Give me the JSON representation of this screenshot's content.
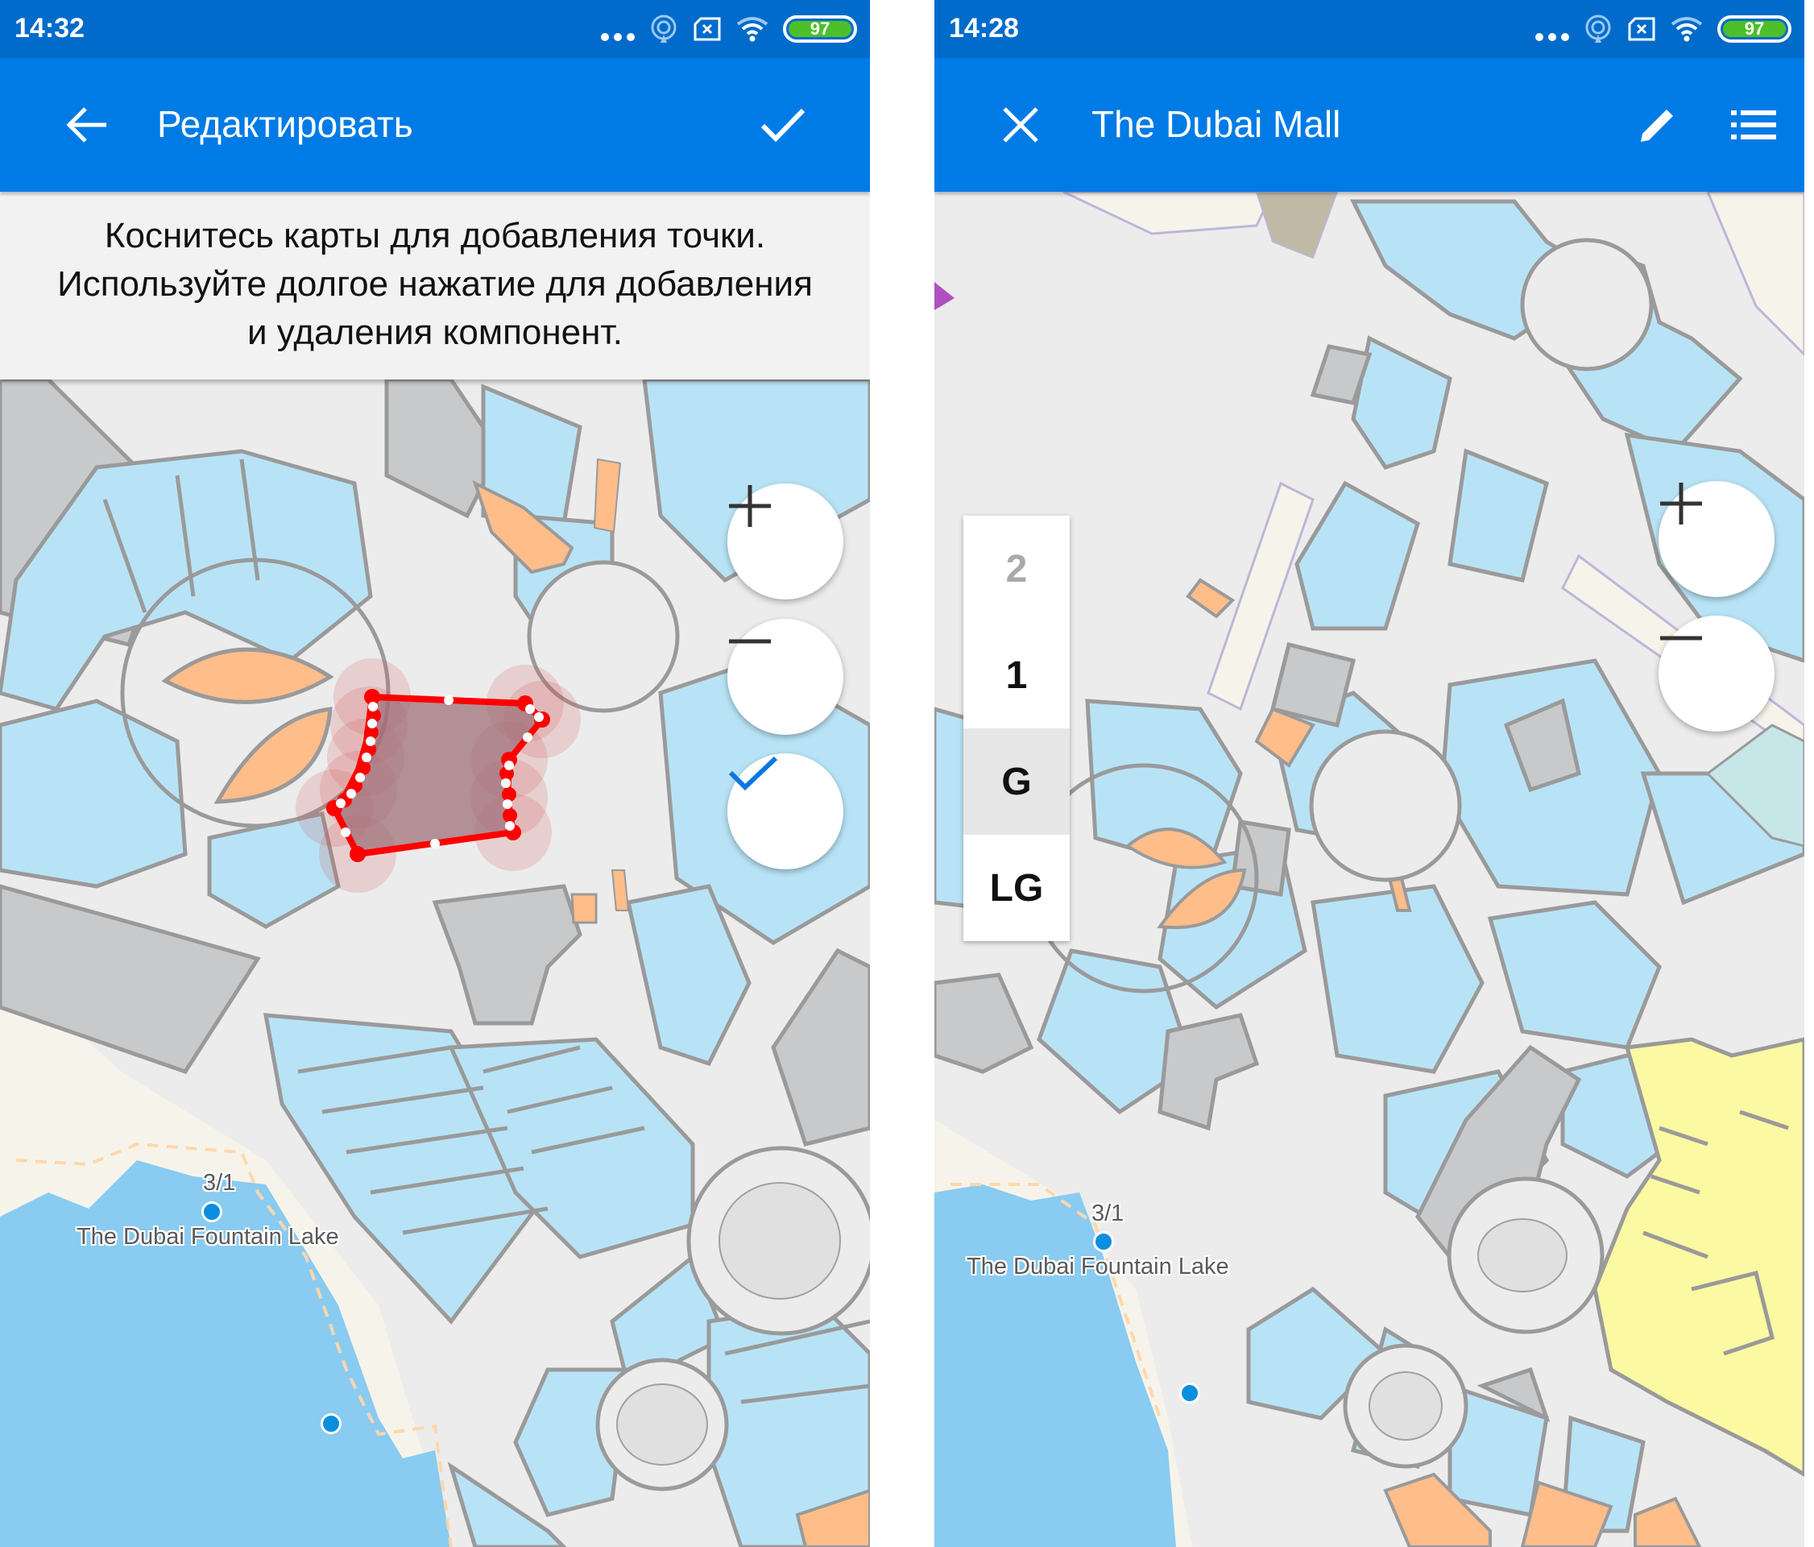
{
  "left_screen": {
    "status_bar": {
      "time": "14:32",
      "battery": "97",
      "icons": [
        "more-dots-icon",
        "hotspot-icon",
        "sim-off-icon",
        "wifi-icon",
        "battery-icon"
      ]
    },
    "app_bar": {
      "nav_icon": "back-arrow-icon",
      "title": "Редактировать",
      "action_icon": "check-icon"
    },
    "instruction": {
      "lines": [
        "Коснитесь карты для добавления точки.",
        "Используйте долгое нажатие для добавления",
        "и удаления компонент."
      ]
    },
    "map": {
      "labels": {
        "lake": "The Dubai Fountain Lake",
        "marker": "3/1"
      },
      "controls": {
        "zoom_in": "zoom-in-icon",
        "zoom_out": "zoom-out-icon",
        "confirm": "check-icon"
      },
      "edit_polygon": {
        "stroke_color": "#ff0000",
        "fill_color": "#a0707a"
      }
    }
  },
  "right_screen": {
    "status_bar": {
      "time": "14:28",
      "battery": "97",
      "icons": [
        "more-dots-icon",
        "hotspot-icon",
        "sim-off-icon",
        "wifi-icon",
        "battery-icon"
      ]
    },
    "app_bar": {
      "nav_icon": "close-icon",
      "title": "The Dubai Mall",
      "actions": [
        "edit-pencil-icon",
        "list-icon"
      ]
    },
    "floor_selector": {
      "floors": [
        {
          "label": "2",
          "state": "disabled"
        },
        {
          "label": "1",
          "state": "normal"
        },
        {
          "label": "G",
          "state": "selected"
        },
        {
          "label": "LG",
          "state": "normal"
        }
      ],
      "selected": "G"
    },
    "map": {
      "labels": {
        "lake": "The Dubai Fountain Lake",
        "marker": "3/1"
      },
      "controls": {
        "zoom_in": "zoom-in-icon",
        "zoom_out": "zoom-out-icon"
      }
    }
  },
  "colors": {
    "status_bar": "#006bcb",
    "app_bar": "#007be6",
    "store": "#b8e3f6",
    "corridor": "#ececec",
    "service": "#c8c9cb",
    "food": "#ffbd8a",
    "yellow_zone": "#fbf9a2",
    "water": "#89cbf1",
    "land": "#f6f4ea",
    "accent_check": "#0a78e0"
  }
}
